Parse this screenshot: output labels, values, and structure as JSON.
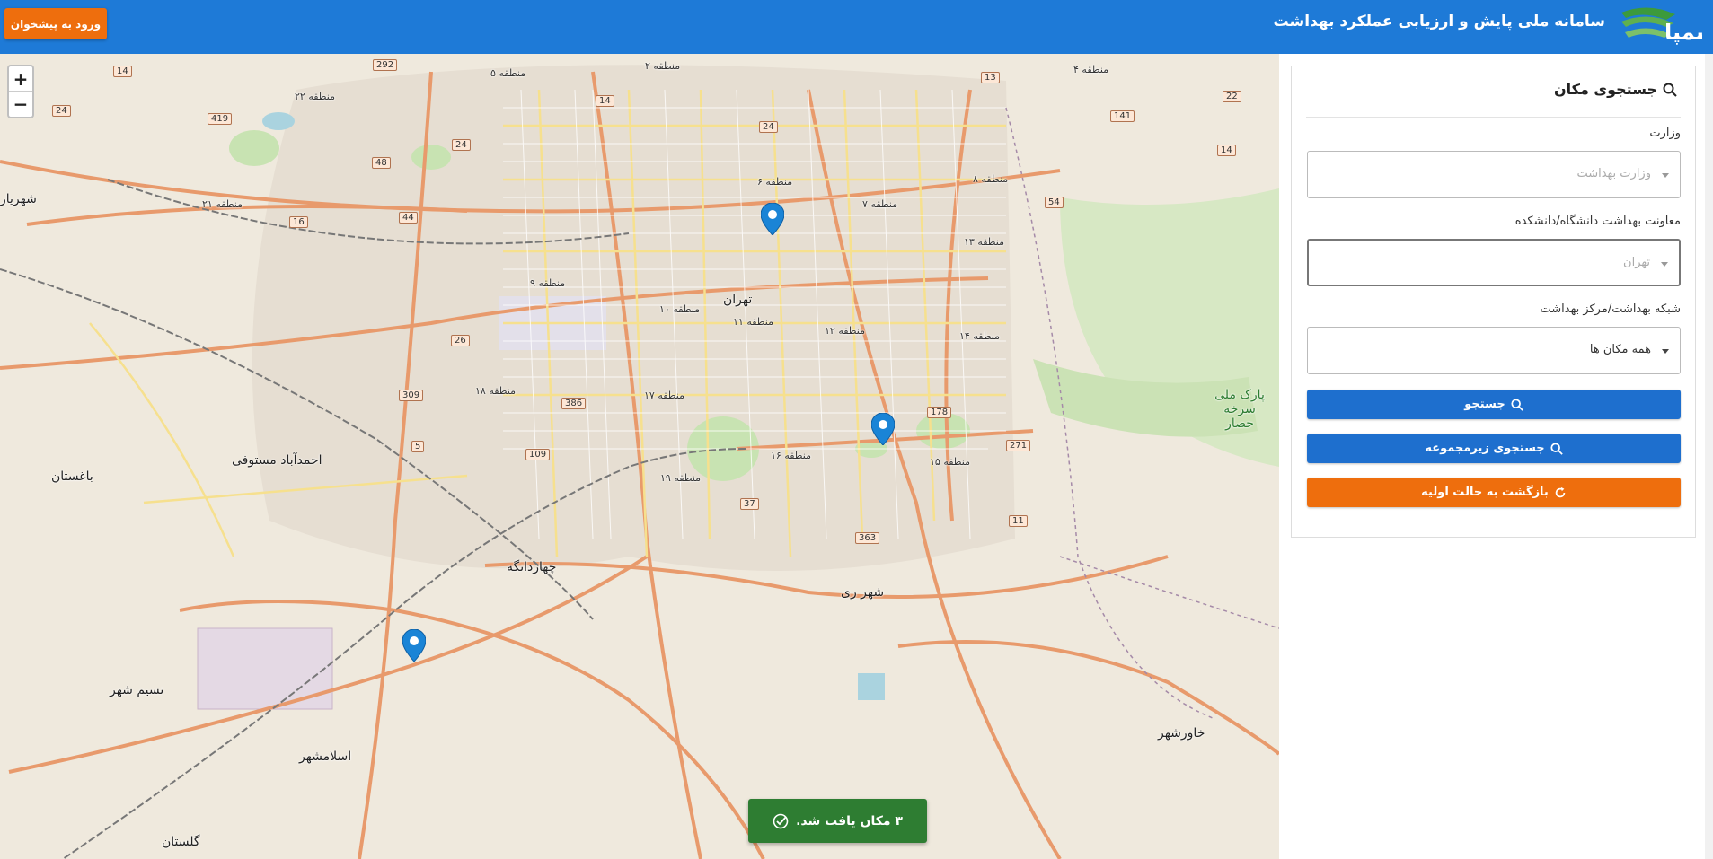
{
  "header": {
    "title": "سامانه ملی پایش و ارزیابی عملکرد بهداشت",
    "logo_text": "سمپا",
    "proposal_button": "ورود به پیشخوان"
  },
  "map": {
    "zoom_in": "+",
    "zoom_out": "−",
    "labels": {
      "tehran": "تهران",
      "region5": "منطقه ۵",
      "region2": "منطقه ۲",
      "region4": "منطقه ۴",
      "region22": "منطقه ۲۲",
      "region21": "منطقه ۲۱",
      "region6": "منطقه ۶",
      "region7": "منطقه ۷",
      "region8": "منطقه ۸",
      "region9": "منطقه ۹",
      "region10": "منطقه ۱۰",
      "region11": "منطقه ۱۱",
      "region12": "منطقه ۱۲",
      "region13": "منطقه ۱۳",
      "region14": "منطقه ۱۴",
      "region15": "منطقه ۱۵",
      "region16": "منطقه ۱۶",
      "region17": "منطقه ۱۷",
      "region18": "منطقه ۱۸",
      "region19": "منطقه ۱۹",
      "shahr_rey": "شهر ری",
      "eslamshahr": "اسلامشهر",
      "chahardangeh": "چهاردانگه",
      "park": "پارک ملی سرخه حصار",
      "golestan": "گلستان",
      "nasim_shahr": "نسیم شهر",
      "baghestan": "باغستان",
      "ahmadabad": "احمدآباد مستوفی",
      "javadabad": "خاورشهر",
      "shahriar": "شهریار"
    },
    "toast": "۳ مکان یافت شد."
  },
  "panel": {
    "title": "جستجوی مکان",
    "ministry_label": "وزارت",
    "ministry_value": "وزارت بهداشت",
    "deputy_label": "معاونت بهداشت دانشگاه/دانشکده",
    "deputy_value": "تهران",
    "network_label": "شبکه بهداشت/مرکز بهداشت",
    "network_value": "همه مکان ها",
    "search_button": "جستجو",
    "sub_search_button": "جستجوی زیرمجموعه",
    "reset_button": "بازگشت به حالت اولیه"
  },
  "colors": {
    "header_bg": "#1e7ad7",
    "orange": "#ee6e0d",
    "blue_button": "#1e6fce",
    "toast_bg": "#2e7d32",
    "marker": "#1a84d6"
  }
}
